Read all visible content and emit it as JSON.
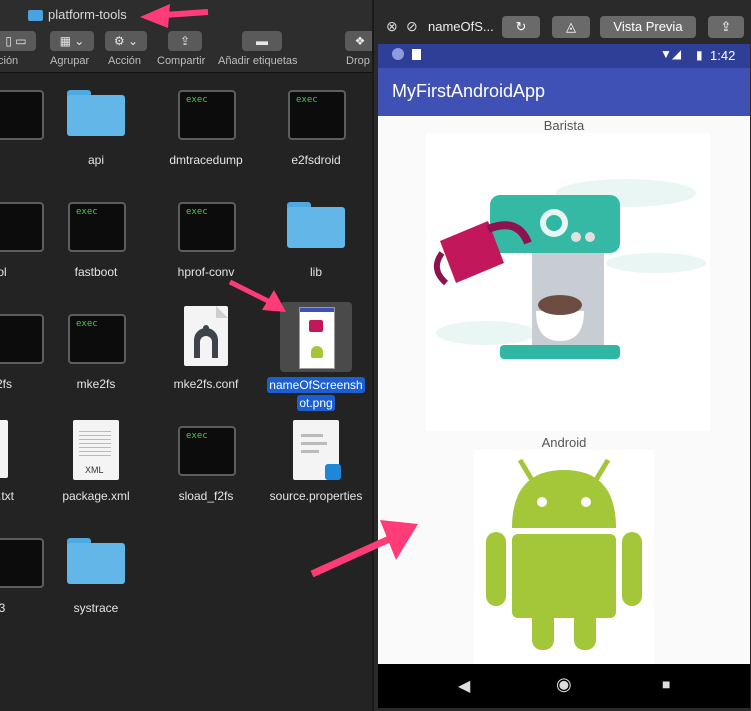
{
  "finder": {
    "window_title": "platform-tools",
    "toolbar": {
      "labels": [
        "ción",
        "Agrupar",
        "Acción",
        "Compartir",
        "Añadir etiquetas",
        "Drop"
      ]
    },
    "items": [
      {
        "label": "api",
        "kind": "folder"
      },
      {
        "label": "dmtracedump",
        "kind": "exec"
      },
      {
        "label": "e2fsdroid",
        "kind": "exec"
      },
      {
        "label": "ol",
        "kind": "exec"
      },
      {
        "label": "fastboot",
        "kind": "exec"
      },
      {
        "label": "hprof-conv",
        "kind": "exec"
      },
      {
        "label": "lib",
        "kind": "folder"
      },
      {
        "label": "2fs",
        "kind": "exec"
      },
      {
        "label": "mke2fs",
        "kind": "exec"
      },
      {
        "label": "mke2fs.conf",
        "kind": "doc"
      },
      {
        "label_line1": "nameOfScreensh",
        "label_line2": "ot.png",
        "kind": "png-selected"
      },
      {
        "label": ".txt",
        "kind": "doc"
      },
      {
        "label": "package.xml",
        "kind": "xml"
      },
      {
        "label": "sload_f2fs",
        "kind": "exec"
      },
      {
        "label": "source.properties",
        "kind": "doc"
      },
      {
        "label": "3",
        "kind": "exec"
      },
      {
        "label": "systrace",
        "kind": "folder"
      }
    ],
    "exec_badge": "exec",
    "xml_badge": "XML"
  },
  "emulator": {
    "tab_title": "nameOfS...",
    "preview_button": "Vista Previa",
    "status_time": "1:42",
    "app_title": "MyFirstAndroidApp",
    "caption_barista": "Barista",
    "caption_android": "Android"
  },
  "colors": {
    "accent_arrow": "#ff3c78",
    "app_bar": "#3f51b5",
    "android_green": "#a4c639",
    "selection_blue": "#1b5fd0"
  }
}
